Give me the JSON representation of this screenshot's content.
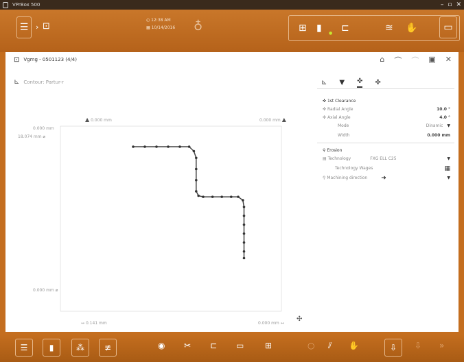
{
  "window": {
    "title": "VPrBox 500",
    "min_icon": "minimize-icon",
    "max_icon": "maximize-icon",
    "close_icon": "close-icon"
  },
  "topbar": {
    "menu_icon": "menu-icon",
    "breadcrumb_icon": "document-edit-icon",
    "time": "12:38 AM",
    "date": "10/14/2016",
    "user_icon": "user-icon"
  },
  "main": {
    "title": "Vgmg - 0501123 (4/4)",
    "contour_label": "Contour: Partur-r",
    "plot": {
      "top_left": "0.000 mm",
      "top_right": "0.000 mm",
      "left_1": "0.000 mm",
      "left_2": "18.074 mm",
      "left_bottom": "0.000 mm",
      "bottom_left": "0.141 mm",
      "bottom_right": "0.000 mm"
    }
  },
  "right_panel": {
    "section1_title": "1st Clearance",
    "radial_angle_label": "Radial Angle",
    "radial_angle_value": "10.0 °",
    "axial_angle_label": "Axial Angle",
    "axial_angle_value": "4.0 °",
    "mode_label": "Mode",
    "mode_value": "Dinamic",
    "width_label": "Width",
    "width_value": "0.000 mm",
    "section2_title": "Erosion",
    "technology_label": "Technology",
    "technology_value": "FXG ELL C25",
    "technology_wages_label": "Technology Wages",
    "machining_direction_label": "Machining direction"
  },
  "chart_data": {
    "type": "line",
    "title": "",
    "series": [
      {
        "values": [
          [
            0,
            100
          ],
          [
            10,
            100
          ],
          [
            20,
            100
          ],
          [
            30,
            100
          ],
          [
            40,
            100
          ],
          [
            48,
            100
          ],
          [
            52,
            96
          ],
          [
            54,
            90
          ],
          [
            54,
            80
          ],
          [
            54,
            70
          ],
          [
            54,
            60
          ],
          [
            56,
            56
          ],
          [
            60,
            55
          ],
          [
            68,
            55
          ],
          [
            76,
            55
          ],
          [
            84,
            55
          ],
          [
            90,
            55
          ],
          [
            94,
            52
          ],
          [
            95,
            46
          ],
          [
            95,
            38
          ],
          [
            95,
            30
          ],
          [
            95,
            22
          ],
          [
            95,
            14
          ],
          [
            95,
            6
          ],
          [
            95,
            0
          ]
        ]
      }
    ]
  }
}
